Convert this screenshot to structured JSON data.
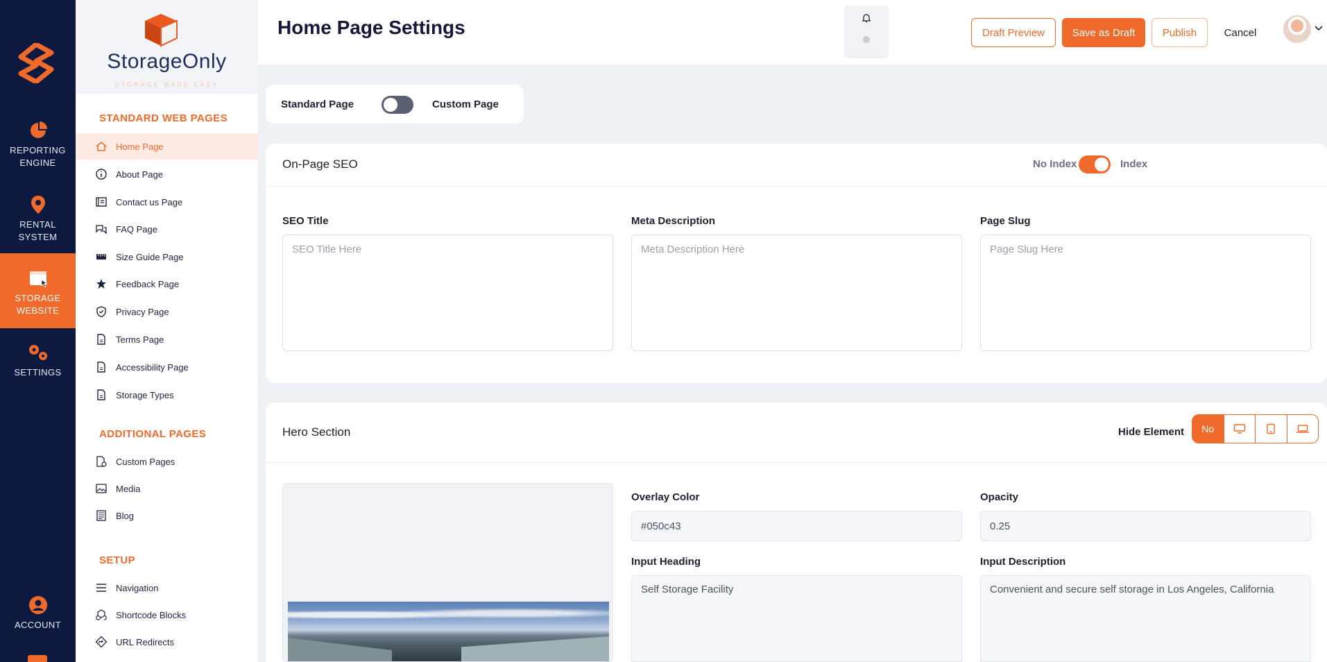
{
  "rail": {
    "items": [
      {
        "label1": "REPORTING",
        "label2": "ENGINE"
      },
      {
        "label1": "RENTAL",
        "label2": "SYSTEM"
      },
      {
        "label1": "STORAGE",
        "label2": "WEBSITE"
      },
      {
        "label1": "SETTINGS",
        "label2": ""
      },
      {
        "label1": "ACCOUNT",
        "label2": ""
      }
    ]
  },
  "brand": {
    "name": "StorageOnly",
    "tagline": "STORAGE MADE EASY"
  },
  "sidebar": {
    "standard_title": "STANDARD WEB PAGES",
    "standard": [
      "Home Page",
      "About Page",
      "Contact us Page",
      "FAQ Page",
      "Size Guide Page",
      "Feedback Page",
      "Privacy Page",
      "Terms Page",
      "Accessibility Page",
      "Storage Types"
    ],
    "additional_title": "ADDITIONAL PAGES",
    "additional": [
      "Custom Pages",
      "Media",
      "Blog"
    ],
    "setup_title": "SETUP",
    "setup": [
      "Navigation",
      "Shortcode Blocks",
      "URL Redirects"
    ]
  },
  "header": {
    "title": "Home Page Settings",
    "draft_preview": "Draft Preview",
    "save_draft": "Save as Draft",
    "publish": "Publish",
    "cancel": "Cancel"
  },
  "page_type": {
    "left": "Standard Page",
    "right": "Custom Page",
    "custom_enabled": false
  },
  "seo": {
    "title": "On-Page SEO",
    "no_index": "No Index",
    "index": "Index",
    "index_enabled": true,
    "fields": [
      {
        "label": "SEO Title",
        "placeholder": "SEO Title Here"
      },
      {
        "label": "Meta Description",
        "placeholder": "Meta Description Here"
      },
      {
        "label": "Page Slug",
        "placeholder": "Page Slug Here"
      }
    ]
  },
  "hero": {
    "title": "Hero Section",
    "hide_label": "Hide Element",
    "hide_options": [
      "No",
      "desktop-icon",
      "tablet-icon",
      "laptop-icon"
    ],
    "overlay_label": "Overlay Color",
    "overlay_value": "#050c43",
    "opacity_label": "Opacity",
    "opacity_value": "0.25",
    "heading_label": "Input Heading",
    "heading_value": "Self Storage Facility",
    "description_label": "Input Description",
    "description_value": "Convenient and secure self storage in Los Angeles, California"
  },
  "colors": {
    "accent": "#ef6a2a",
    "rail": "#0e1940"
  }
}
